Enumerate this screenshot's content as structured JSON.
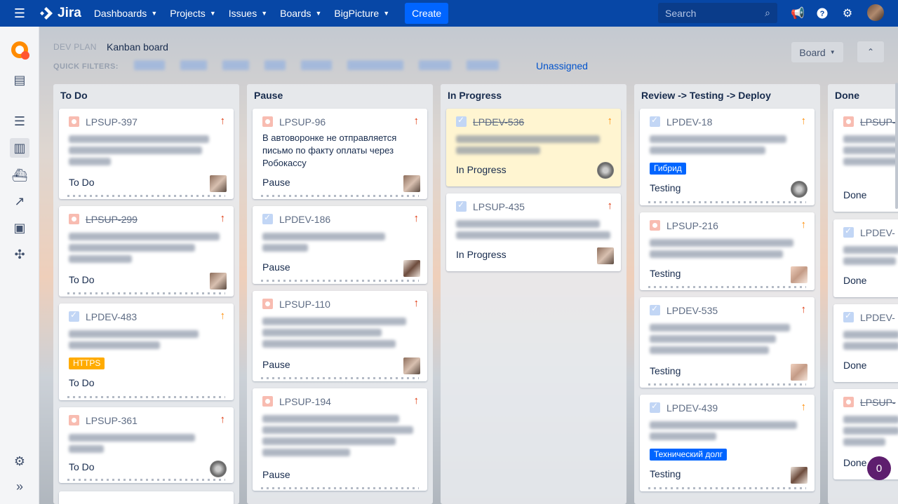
{
  "topnav": {
    "brand": "Jira",
    "items": [
      "Dashboards",
      "Projects",
      "Issues",
      "Boards",
      "BigPicture"
    ],
    "create": "Create",
    "search_placeholder": "Search"
  },
  "header": {
    "breadcrumb": "DEV PLAN",
    "title": "Kanban board",
    "quick_filters_label": "QUICK FILTERS:",
    "unassigned": "Unassigned",
    "board_button": "Board"
  },
  "columns": [
    {
      "title": "To Do",
      "cards": [
        {
          "key": "LPSUP-397",
          "type": "bug",
          "prio": "red",
          "status": "To Do",
          "done": false
        },
        {
          "key": "LPSUP-299",
          "type": "bug",
          "prio": "red",
          "status": "To Do",
          "done": true
        },
        {
          "key": "LPDEV-483",
          "type": "task",
          "prio": "orange",
          "status": "To Do",
          "done": false,
          "label": "HTTPS"
        },
        {
          "key": "LPSUP-361",
          "type": "bug",
          "prio": "red",
          "status": "To Do",
          "done": false
        }
      ]
    },
    {
      "title": "Pause",
      "cards": [
        {
          "key": "LPSUP-96",
          "type": "bug",
          "prio": "red",
          "status": "Pause",
          "done": false,
          "summary": "В автоворонке не отправляется письмо по факту оплаты через Робокассу"
        },
        {
          "key": "LPDEV-186",
          "type": "task",
          "prio": "red",
          "status": "Pause",
          "done": false
        },
        {
          "key": "LPSUP-110",
          "type": "bug",
          "prio": "red",
          "status": "Pause",
          "done": false
        },
        {
          "key": "LPSUP-194",
          "type": "bug",
          "prio": "red",
          "status": "Pause",
          "done": false
        }
      ]
    },
    {
      "title": "In Progress",
      "cards": [
        {
          "key": "LPDEV-536",
          "type": "task",
          "prio": "orange",
          "status": "In Progress",
          "done": true
        },
        {
          "key": "LPSUP-435",
          "type": "task",
          "prio": "red",
          "status": "In Progress",
          "done": false
        }
      ]
    },
    {
      "title": "Review -> Testing -> Deploy",
      "cards": [
        {
          "key": "LPDEV-18",
          "type": "task",
          "prio": "orange",
          "status": "Testing",
          "done": false,
          "label": "Гибрид"
        },
        {
          "key": "LPSUP-216",
          "type": "bug",
          "prio": "orange",
          "status": "Testing",
          "done": false
        },
        {
          "key": "LPDEV-535",
          "type": "task",
          "prio": "red",
          "status": "Testing",
          "done": false
        },
        {
          "key": "LPDEV-439",
          "type": "task",
          "prio": "orange",
          "status": "Testing",
          "done": false,
          "label": "Технический долг"
        }
      ]
    },
    {
      "title": "Done",
      "cards": [
        {
          "key": "LPSUP-",
          "status": "Done",
          "done": true
        },
        {
          "key": "LPDEV-",
          "status": "Done",
          "done": false
        },
        {
          "key": "LPDEV-",
          "status": "Done",
          "done": false
        },
        {
          "key": "LPSUP-",
          "status": "Done",
          "done": true
        }
      ]
    }
  ],
  "notification_count": "0"
}
